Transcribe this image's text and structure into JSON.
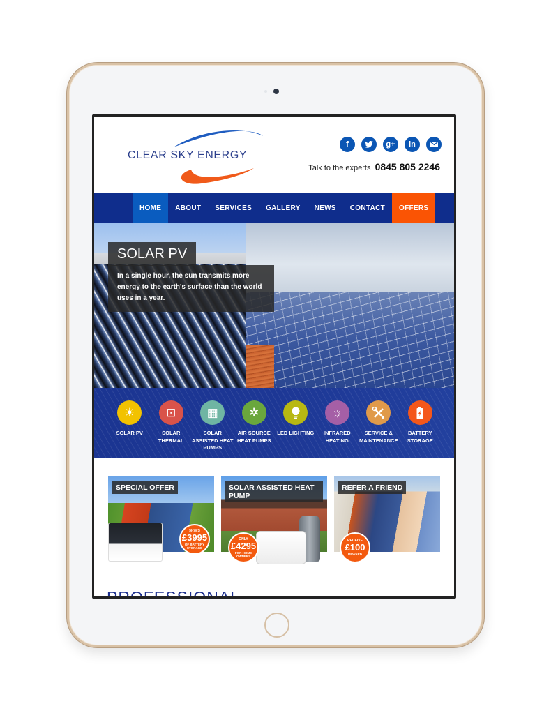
{
  "site": {
    "brand_name": "CLEAR SKY ENERGY",
    "colors": {
      "nav_bg": "#0f2d8c",
      "nav_active": "#0a5cbf",
      "offers": "#fa5404",
      "social": "#0b56b4",
      "logo_blue": "#2b3f8c",
      "logo_orange": "#f05a1a"
    }
  },
  "header": {
    "social_icons": [
      {
        "name": "facebook-icon",
        "glyph": "f"
      },
      {
        "name": "twitter-icon",
        "glyph": "🐦"
      },
      {
        "name": "google-plus-icon",
        "glyph": "g+"
      },
      {
        "name": "linkedin-icon",
        "glyph": "in"
      },
      {
        "name": "email-icon",
        "glyph": "✉"
      }
    ],
    "phone_prefix": "Talk to the experts",
    "phone_number": "0845 805 2246"
  },
  "nav": {
    "items": [
      {
        "label": "HOME",
        "active": true
      },
      {
        "label": "ABOUT"
      },
      {
        "label": "SERVICES"
      },
      {
        "label": "GALLERY"
      },
      {
        "label": "NEWS"
      },
      {
        "label": "CONTACT"
      },
      {
        "label": "OFFERS",
        "highlight": true
      }
    ]
  },
  "hero": {
    "title": "SOLAR PV",
    "text": "In a single hour, the sun transmits more energy to the earth's surface than the world uses in a year."
  },
  "services": [
    {
      "label": "SOLAR PV",
      "icon": "sun-icon",
      "glyph": "☀",
      "color": "#f2c200"
    },
    {
      "label": "SOLAR THERMAL",
      "icon": "cylinder-icon",
      "glyph": "⊡",
      "color": "#d9534a"
    },
    {
      "label": "SOLAR ASSISTED HEAT PUMPS",
      "icon": "solar-panel-icon",
      "glyph": "▦",
      "color": "#6fb5a3"
    },
    {
      "label": "AIR SOURCE HEAT PUMPS",
      "icon": "fan-icon",
      "glyph": "✲",
      "color": "#6aa73d"
    },
    {
      "label": "LED LIGHTING",
      "icon": "lightbulb-icon",
      "glyph": "💡",
      "color": "#b8b812"
    },
    {
      "label": "INFRARED HEATING",
      "icon": "heater-icon",
      "glyph": "☼",
      "color": "#a55fa6"
    },
    {
      "label": "SERVICE & MAINTENANCE",
      "icon": "tools-icon",
      "glyph": "✕",
      "color": "#e09a4a"
    },
    {
      "label": "BATTERY STORAGE",
      "icon": "battery-icon",
      "glyph": "⚡",
      "color": "#f4571b"
    }
  ],
  "promos": [
    {
      "label": "SPECIAL OFFER",
      "badge_top": "5KW'S",
      "badge_price": "£3995",
      "badge_bottom": "OF BATTERY STORAGE"
    },
    {
      "label": "SOLAR ASSISTED HEAT PUMP",
      "badge_top": "ONLY",
      "badge_price": "£4295",
      "badge_bottom": "FOR HOME OWNERS"
    },
    {
      "label": "REFER A FRIEND",
      "badge_top": "RECEIVE",
      "badge_price": "£100",
      "badge_bottom": "REWARD"
    }
  ],
  "section_heading": "PROFESSIONAL"
}
